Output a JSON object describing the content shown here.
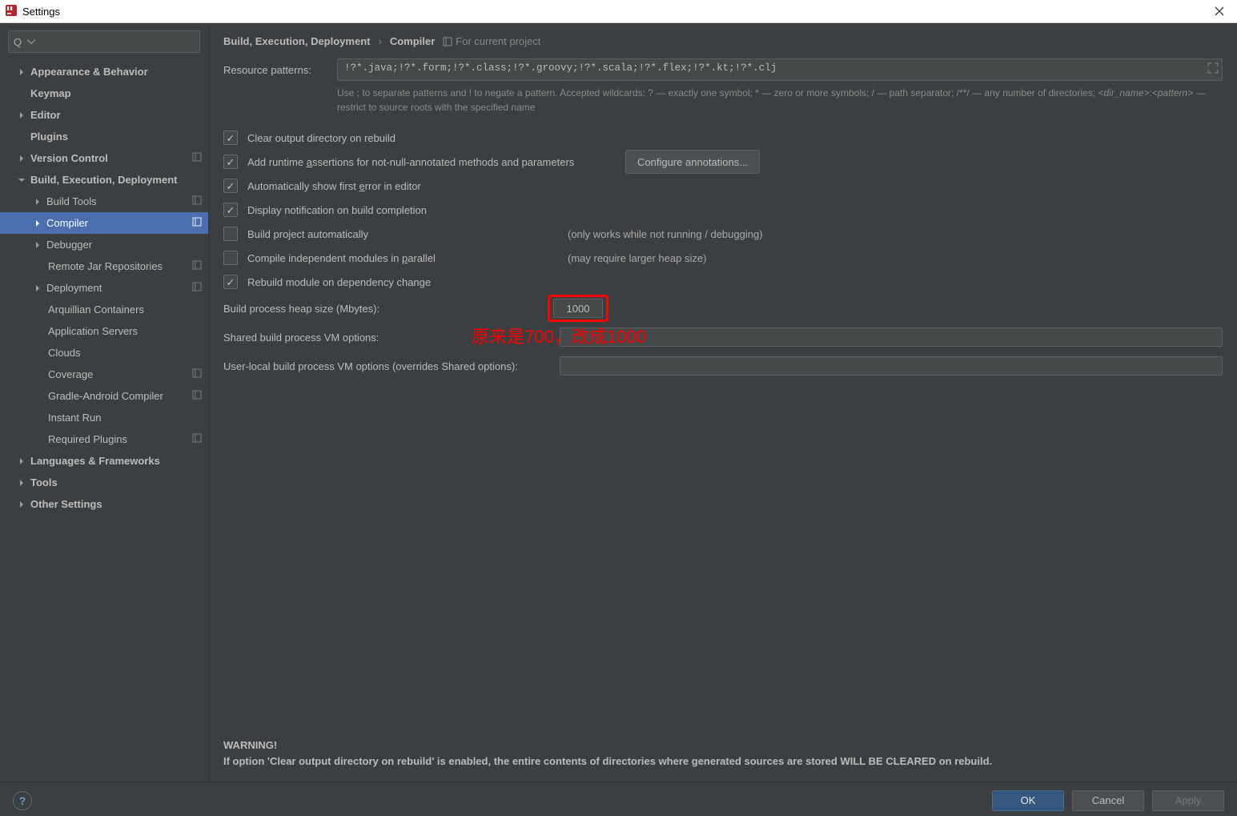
{
  "window": {
    "title": "Settings"
  },
  "search": {
    "placeholder": ""
  },
  "sidebar": {
    "items": {
      "appearance": "Appearance & Behavior",
      "keymap": "Keymap",
      "editor": "Editor",
      "plugins": "Plugins",
      "version_control": "Version Control",
      "bed": "Build, Execution, Deployment",
      "bed_build_tools": "Build Tools",
      "bed_compiler": "Compiler",
      "bed_debugger": "Debugger",
      "bed_remote_jar": "Remote Jar Repositories",
      "bed_deployment": "Deployment",
      "bed_arquillian": "Arquillian Containers",
      "bed_app_servers": "Application Servers",
      "bed_clouds": "Clouds",
      "bed_coverage": "Coverage",
      "bed_gradle_android": "Gradle-Android Compiler",
      "bed_instant_run": "Instant Run",
      "bed_required_plugins": "Required Plugins",
      "languages": "Languages & Frameworks",
      "tools": "Tools",
      "other": "Other Settings"
    }
  },
  "breadcrumb": {
    "part1": "Build, Execution, Deployment",
    "part2": "Compiler",
    "for_project": "For current project"
  },
  "resource_patterns": {
    "label": "Resource patterns:",
    "value": "!?*.java;!?*.form;!?*.class;!?*.groovy;!?*.scala;!?*.flex;!?*.kt;!?*.clj",
    "hint_prefix": "Use ; to separate patterns and ! to negate a pattern. Accepted wildcards: ? — exactly one symbol; * — zero or more symbols; / — path separator; /**/ — any number of directories; ",
    "hint_dir": "<dir_name>",
    "hint_colon": ":",
    "hint_pattern": "<pattern>",
    "hint_suffix": " — restrict to source roots with the specified name"
  },
  "checks": {
    "clear_output": "Clear output directory on rebuild",
    "add_runtime_pre": "Add runtime ",
    "add_runtime_u": "a",
    "add_runtime_post": "ssertions for not-null-annotated methods and parameters",
    "configure_ann": "Configure annotations...",
    "auto_first_error_pre": "Automatically show first ",
    "auto_first_error_u": "e",
    "auto_first_error_post": "rror in editor",
    "display_notification": "Display notification on build completion",
    "build_auto": "Build project automatically",
    "build_auto_note": "(only works while not running / debugging)",
    "compile_parallel_pre": "Compile independent modules in ",
    "compile_parallel_u": "p",
    "compile_parallel_post": "arallel",
    "compile_parallel_note": "(may require larger heap size)",
    "rebuild_dep": "Rebuild module on dependency change"
  },
  "fields": {
    "heap_label": "Build process heap size (Mbytes):",
    "heap_value": "1000",
    "shared_vm_label": "Shared build process VM options:",
    "shared_vm_value": "",
    "user_vm_label": "User-local build process VM options (overrides Shared options):",
    "user_vm_value": ""
  },
  "annotation": {
    "text": "原来是700，改成1000"
  },
  "warning": {
    "title": "WARNING!",
    "body": "If option 'Clear output directory on rebuild' is enabled, the entire contents of directories where generated sources are stored WILL BE CLEARED on rebuild."
  },
  "footer": {
    "help": "?",
    "ok": "OK",
    "cancel": "Cancel",
    "apply": "Apply"
  }
}
